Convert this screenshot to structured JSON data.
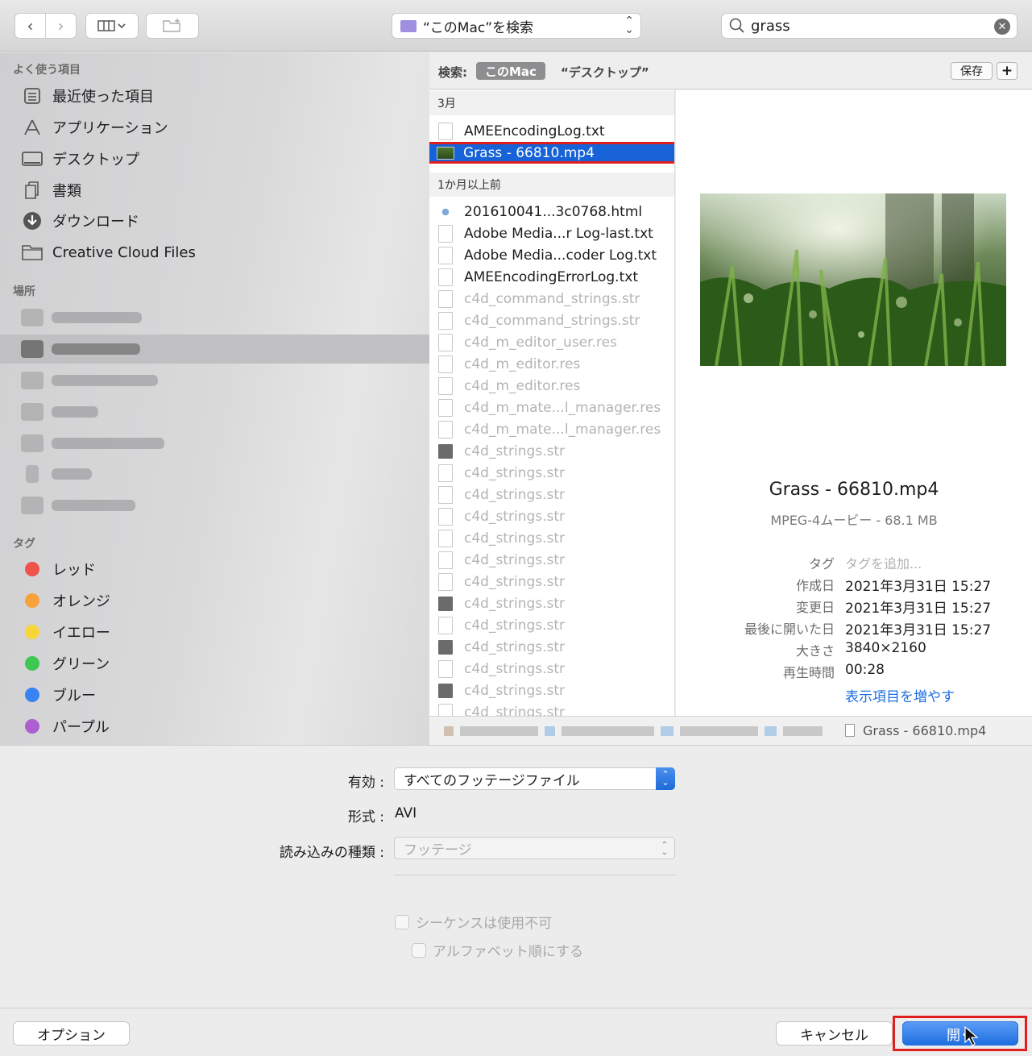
{
  "toolbar": {
    "location": "“このMac”を検索",
    "search_value": "grass"
  },
  "sidebar": {
    "favorites_header": "よく使う項目",
    "favorites": [
      {
        "label": "最近使った項目",
        "icon": "recents-icon"
      },
      {
        "label": "アプリケーション",
        "icon": "applications-icon"
      },
      {
        "label": "デスクトップ",
        "icon": "desktop-icon"
      },
      {
        "label": "書類",
        "icon": "documents-icon"
      },
      {
        "label": "ダウンロード",
        "icon": "downloads-icon"
      },
      {
        "label": "Creative Cloud Files",
        "icon": "folder-icon"
      }
    ],
    "locations_header": "場所",
    "tags_header": "タグ",
    "tags": [
      {
        "label": "レッド",
        "color": "#f0524c"
      },
      {
        "label": "オレンジ",
        "color": "#f7a23a"
      },
      {
        "label": "イエロー",
        "color": "#f8d53a"
      },
      {
        "label": "グリーン",
        "color": "#3fc653"
      },
      {
        "label": "ブルー",
        "color": "#3883f2"
      },
      {
        "label": "パープル",
        "color": "#ac5fd0"
      }
    ]
  },
  "scope": {
    "label": "検索:",
    "active": "このMac",
    "other": "“デスクトップ”",
    "save": "保存",
    "add": "+"
  },
  "files": {
    "group1": "3月",
    "group1_items": [
      "AMEEncodingLog.txt",
      "Grass - 66810.mp4"
    ],
    "group2": "1か月以上前",
    "group2_items": [
      "201610041...3c0768.html",
      "Adobe Media...r Log-last.txt",
      "Adobe Media...coder Log.txt",
      "AMEEncodingErrorLog.txt",
      "c4d_command_strings.str",
      "c4d_command_strings.str",
      "c4d_m_editor_user.res",
      "c4d_m_editor.res",
      "c4d_m_editor.res",
      "c4d_m_mate...l_manager.res",
      "c4d_m_mate...l_manager.res",
      "c4d_strings.str",
      "c4d_strings.str",
      "c4d_strings.str",
      "c4d_strings.str",
      "c4d_strings.str",
      "c4d_strings.str",
      "c4d_strings.str",
      "c4d_strings.str",
      "c4d_strings.str",
      "c4d_strings.str",
      "c4d_strings.str",
      "c4d_strings.str",
      "c4d_strings.str"
    ]
  },
  "preview": {
    "name": "Grass - 66810.mp4",
    "kind": "MPEG-4ムービー - 68.1 MB",
    "meta": [
      {
        "k": "タグ",
        "v": "タグを追加..."
      },
      {
        "k": "作成日",
        "v": "2021年3月31日 15:27"
      },
      {
        "k": "変更日",
        "v": "2021年3月31日 15:27"
      },
      {
        "k": "最後に開いた日",
        "v": "2021年3月31日 15:27"
      },
      {
        "k": "大きさ",
        "v": "3840×2160"
      },
      {
        "k": "再生時間",
        "v": "00:28"
      }
    ],
    "more": "表示項目を増やす"
  },
  "pathbar": {
    "file": "Grass - 66810.mp4"
  },
  "options": {
    "enable_label": "有効 :",
    "enable_value": "すべてのフッテージファイル",
    "format_label": "形式 :",
    "format_value": "AVI",
    "import_label": "読み込みの種類 :",
    "import_value": "フッテージ",
    "sequence_label": "シーケンスは使用不可",
    "alpha_label": "アルファベット順にする"
  },
  "footer": {
    "options": "オプション",
    "cancel": "キャンセル",
    "open": "開く"
  }
}
